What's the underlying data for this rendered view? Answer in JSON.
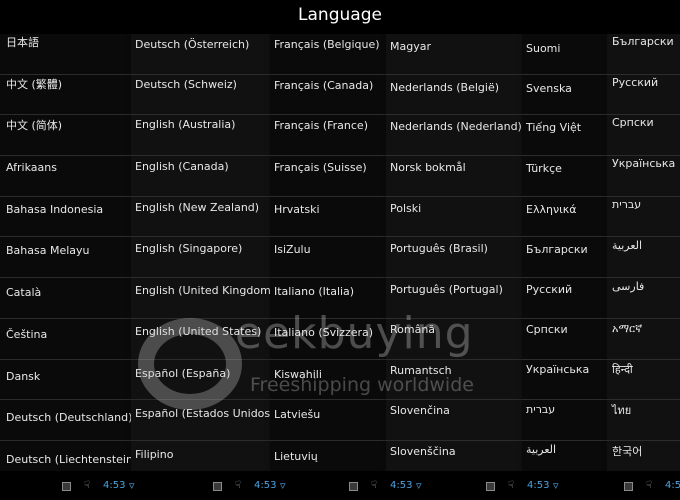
{
  "header": {
    "title": "Language"
  },
  "columns": [
    {
      "items": [
        "日本語",
        "中文 (繁體)",
        "中文 (简体)",
        "Afrikaans",
        "Bahasa Indonesia",
        "Bahasa Melayu",
        "Català",
        "Čeština",
        "Dansk",
        "Deutsch (Deutschland)",
        "Deutsch (Liechtenstein)"
      ]
    },
    {
      "items": [
        "Deutsch (Österreich)",
        "Deutsch (Schweiz)",
        "English (Australia)",
        "English (Canada)",
        "English (New Zealand)",
        "English (Singapore)",
        "English (United Kingdom)",
        "English (United States)",
        "Español (España)",
        "Español (Estados Unidos)",
        "Filipino"
      ]
    },
    {
      "items": [
        "Français (Belgique)",
        "Français (Canada)",
        "Français (France)",
        "Français (Suisse)",
        "Hrvatski",
        "IsiZulu",
        "Italiano (Italia)",
        "Italiano (Svizzera)",
        "Kiswahili",
        "Latviešu",
        "Lietuvių"
      ]
    },
    {
      "items": [
        "Magyar",
        "Nederlands (België)",
        "Nederlands (Nederland)",
        "Norsk bokmål",
        "Polski",
        "Português (Brasil)",
        "Português (Portugal)",
        "Română",
        "Rumantsch",
        "Slovenčina",
        "Slovenščina"
      ]
    },
    {
      "items": [
        "Suomi",
        "Svenska",
        "Tiếng Việt",
        "Türkçe",
        "Ελληνικά",
        "Български",
        "Русский",
        "Српски",
        "Українська",
        "עברית",
        "العربية"
      ]
    },
    {
      "items": [
        "Български",
        "Русский",
        "Српски",
        "Українська",
        "עברית",
        "العربية",
        "فارسی",
        "አማርኛ",
        "हिन्दी",
        "ไทย",
        "한국어"
      ]
    }
  ],
  "status_bar": {
    "segments": [
      {
        "time": "4:53"
      },
      {
        "time": "4:53"
      },
      {
        "time": "4:53"
      },
      {
        "time": "4:53"
      },
      {
        "time": "4:53"
      }
    ]
  },
  "watermark": {
    "brand": "eekbuying",
    "tagline": "Freeshipping worldwide"
  },
  "colors": {
    "status_accent": "#4aa3df",
    "background": "#000000",
    "text": "#e8e8e8"
  }
}
